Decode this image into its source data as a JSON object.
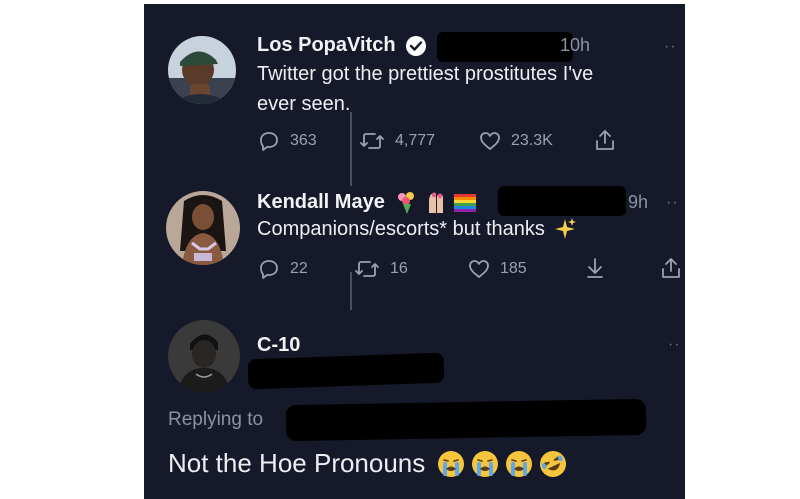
{
  "tweets": [
    {
      "display_name": "Los PopaVitch",
      "verified": true,
      "time": "10h",
      "text_line1": "Twitter got the prettiest prostitutes I've",
      "text_line2": "ever seen.",
      "replies": "363",
      "retweets": "4,777",
      "likes": "23.3K"
    },
    {
      "display_name": "Kendall Maye",
      "name_emojis": [
        "bouquet-icon",
        "nail-polish-icon",
        "rainbow-flag-icon"
      ],
      "time": "9h",
      "text": "Companions/escorts* but thanks",
      "text_emoji": "sparkles-icon",
      "replies": "22",
      "retweets": "16",
      "likes": "185"
    },
    {
      "display_name": "C-10",
      "replying_label": "Replying to",
      "text": "Not the Hoe Pronouns",
      "text_emojis": [
        "crying-face-icon",
        "crying-face-icon",
        "crying-face-icon",
        "rolling-laughing-face-icon"
      ]
    }
  ],
  "more_glyph": "··",
  "colors": {
    "background": "#16192a",
    "text": "#eceef2",
    "muted": "#8b93a3",
    "verified": "#ffffff"
  }
}
